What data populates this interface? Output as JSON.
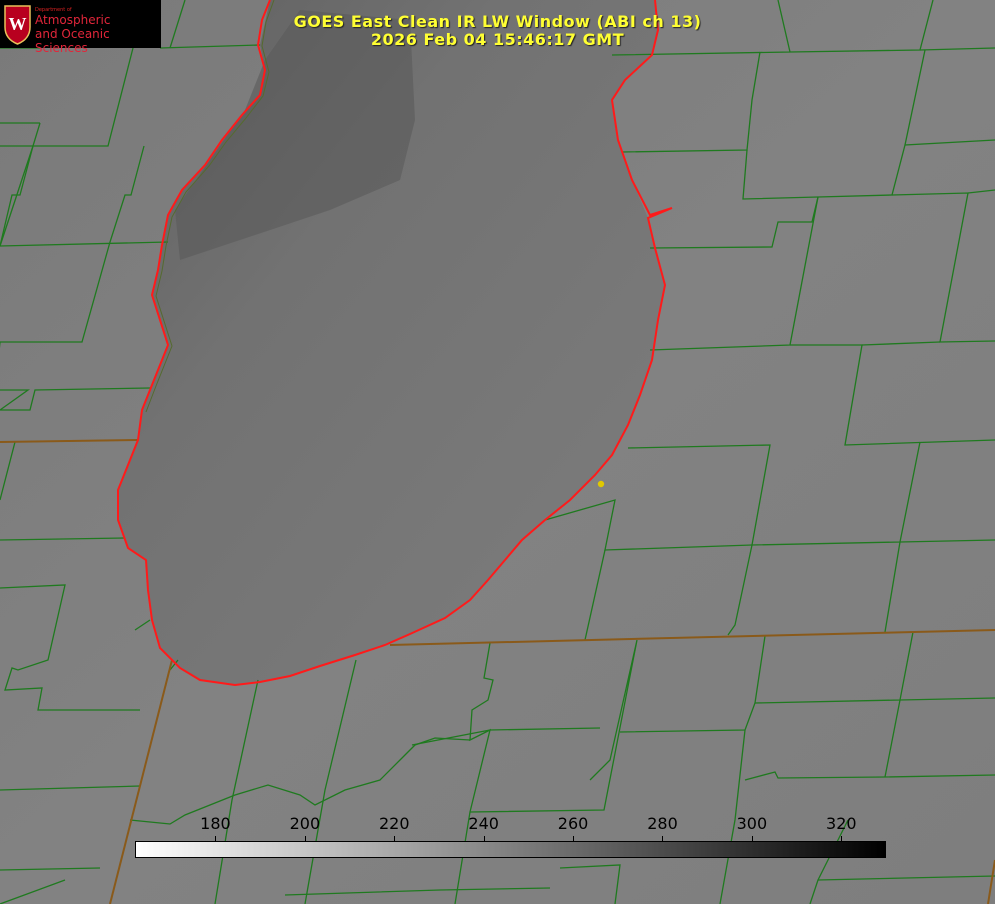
{
  "title": {
    "line1": "GOES East Clean IR LW Window (ABI ch 13)",
    "line2": "2026 Feb 04 15:46:17 GMT"
  },
  "logo": {
    "dept": "Department of",
    "line1": "Atmospheric",
    "line2": "and Oceanic Sciences",
    "crest_letter": "W"
  },
  "colorbar": {
    "ticks": [
      "180",
      "200",
      "220",
      "240",
      "260",
      "280",
      "300",
      "320"
    ],
    "range": [
      162,
      330
    ],
    "colors": {
      "low": "#ffffff",
      "high": "#000000"
    }
  },
  "colors": {
    "title": "#ffff33",
    "county_lines": "#1f7a1f",
    "state_lines": "#8a5a1a",
    "coastline": "#ff1a1a",
    "marker": "#e0c800"
  }
}
